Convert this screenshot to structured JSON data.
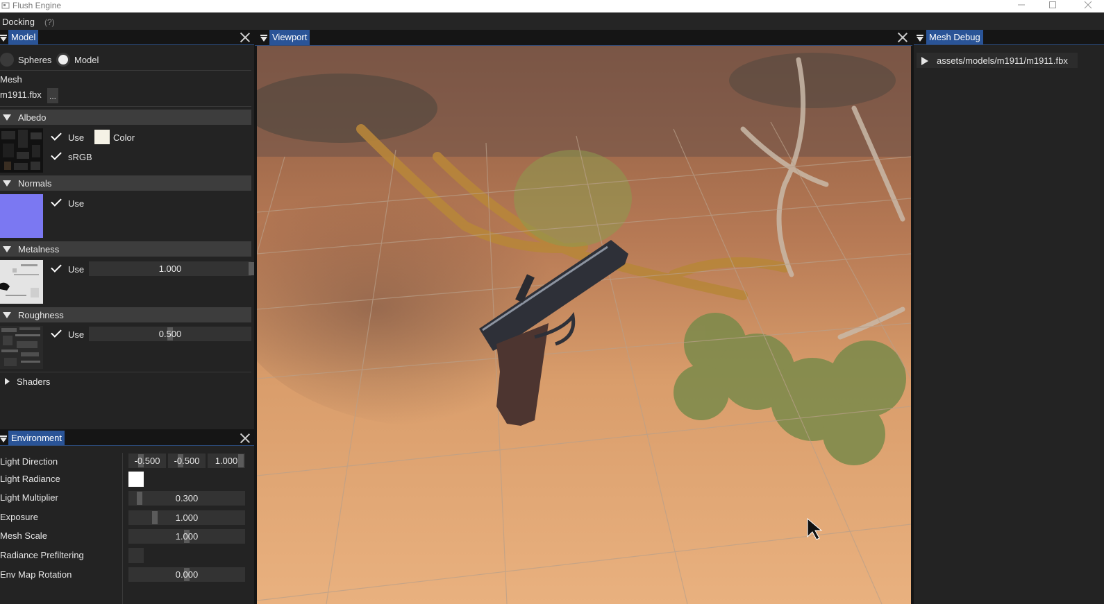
{
  "window": {
    "title": "Flush Engine"
  },
  "menubar": {
    "docking": "Docking",
    "help": "(?)"
  },
  "model_panel": {
    "tab": "Model",
    "radio": {
      "spheres": "Spheres",
      "model": "Model"
    },
    "mesh_label": "Mesh",
    "mesh_file": "m1911.fbx",
    "browse_button": "...",
    "albedo": {
      "header": "Albedo",
      "use": "Use",
      "color": "Color",
      "srgb": "sRGB"
    },
    "normals": {
      "header": "Normals",
      "use": "Use"
    },
    "metalness": {
      "header": "Metalness",
      "use": "Use",
      "value": "1.000",
      "level": 1.0
    },
    "roughness": {
      "header": "Roughness",
      "use": "Use",
      "value": "0.500",
      "level": 0.5
    },
    "shaders": {
      "header": "Shaders"
    }
  },
  "environment_panel": {
    "tab": "Environment",
    "light_direction": {
      "label": "Light Direction",
      "x": "-0.500",
      "y": "-0.500",
      "z": "1.000"
    },
    "light_radiance": {
      "label": "Light Radiance"
    },
    "light_multiplier": {
      "label": "Light Multiplier",
      "value": "0.300"
    },
    "exposure": {
      "label": "Exposure",
      "value": "1.000"
    },
    "mesh_scale": {
      "label": "Mesh Scale",
      "value": "1.000"
    },
    "radiance_prefiltering": {
      "label": "Radiance Prefiltering"
    },
    "env_map_rotation": {
      "label": "Env Map Rotation",
      "value": "0.000"
    }
  },
  "viewport_panel": {
    "tab": "Viewport"
  },
  "mesh_debug_panel": {
    "tab": "Mesh Debug",
    "tree_item": "assets/models/m1911/m1911.fbx"
  },
  "colors": {
    "accent": "#2a5497",
    "panel_bg": "#232323",
    "section_header": "#3d3d3d",
    "normals_swatch": "#7b78f2",
    "albedo_color_swatch": "#f5f2e6",
    "light_radiance_swatch": "#ffffff"
  }
}
